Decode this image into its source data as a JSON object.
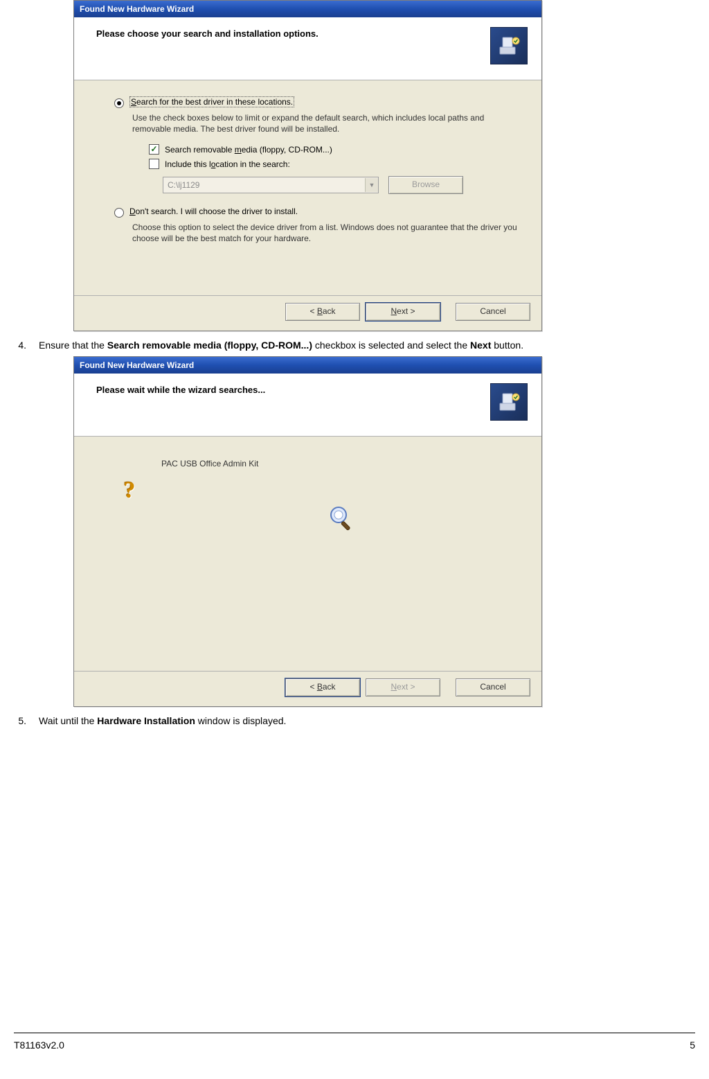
{
  "steps": {
    "s4": {
      "num": "4.",
      "prefix": "Ensure that the ",
      "bold1": "Search removable media (floppy, CD-ROM...)",
      "mid": " checkbox is selected and select the ",
      "bold2": "Next",
      "suffix": " button."
    },
    "s5": {
      "num": "5.",
      "prefix": "Wait until the ",
      "bold1": "Hardware Installation",
      "suffix": " window is displayed."
    }
  },
  "dialog1": {
    "title": "Found New Hardware Wizard",
    "header": "Please choose your search and installation options.",
    "opt1": {
      "prefix": "S",
      "rest": "earch for the best driver in these locations.",
      "desc": "Use the check boxes below to limit or expand the default search, which includes local paths and removable media. The best driver found will be installed."
    },
    "chk1": {
      "pre": "Search removable ",
      "u": "m",
      "post": "edia (floppy, CD-ROM...)"
    },
    "chk2": {
      "pre": "Include this l",
      "u": "o",
      "post": "cation in the search:"
    },
    "path": "C:\\lj1129",
    "browse": "Browse",
    "opt2": {
      "u": "D",
      "rest": "on't search. I will choose the driver to install.",
      "desc": "Choose this option to select the device driver from a list.  Windows does not guarantee that the driver you choose will be the best match for your hardware."
    },
    "buttons": {
      "back": {
        "lt": "< ",
        "u": "B",
        "rest": "ack"
      },
      "next": {
        "u": "N",
        "rest": "ext >"
      },
      "cancel": "Cancel"
    }
  },
  "dialog2": {
    "title": "Found New Hardware Wizard",
    "header": "Please wait while the wizard searches...",
    "device": "PAC USB Office Admin Kit",
    "buttons": {
      "back": {
        "lt": "< ",
        "u": "B",
        "rest": "ack"
      },
      "next": {
        "u": "N",
        "rest": "ext >"
      },
      "cancel": "Cancel"
    }
  },
  "footer": {
    "left": "T81163v2.0",
    "right": "5"
  }
}
